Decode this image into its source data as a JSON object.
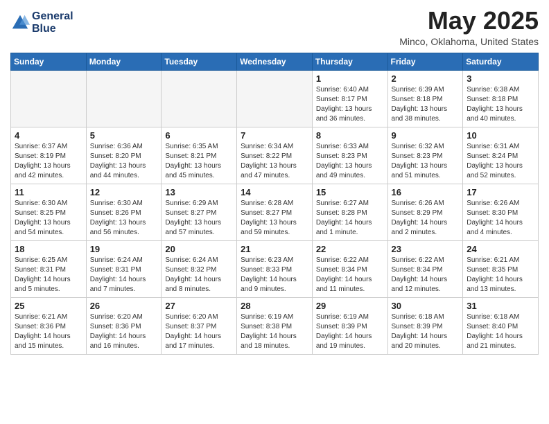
{
  "header": {
    "logo_line1": "General",
    "logo_line2": "Blue",
    "month_title": "May 2025",
    "subtitle": "Minco, Oklahoma, United States"
  },
  "days_of_week": [
    "Sunday",
    "Monday",
    "Tuesday",
    "Wednesday",
    "Thursday",
    "Friday",
    "Saturday"
  ],
  "weeks": [
    [
      {
        "day": "",
        "info": ""
      },
      {
        "day": "",
        "info": ""
      },
      {
        "day": "",
        "info": ""
      },
      {
        "day": "",
        "info": ""
      },
      {
        "day": "1",
        "info": "Sunrise: 6:40 AM\nSunset: 8:17 PM\nDaylight: 13 hours\nand 36 minutes."
      },
      {
        "day": "2",
        "info": "Sunrise: 6:39 AM\nSunset: 8:18 PM\nDaylight: 13 hours\nand 38 minutes."
      },
      {
        "day": "3",
        "info": "Sunrise: 6:38 AM\nSunset: 8:18 PM\nDaylight: 13 hours\nand 40 minutes."
      }
    ],
    [
      {
        "day": "4",
        "info": "Sunrise: 6:37 AM\nSunset: 8:19 PM\nDaylight: 13 hours\nand 42 minutes."
      },
      {
        "day": "5",
        "info": "Sunrise: 6:36 AM\nSunset: 8:20 PM\nDaylight: 13 hours\nand 44 minutes."
      },
      {
        "day": "6",
        "info": "Sunrise: 6:35 AM\nSunset: 8:21 PM\nDaylight: 13 hours\nand 45 minutes."
      },
      {
        "day": "7",
        "info": "Sunrise: 6:34 AM\nSunset: 8:22 PM\nDaylight: 13 hours\nand 47 minutes."
      },
      {
        "day": "8",
        "info": "Sunrise: 6:33 AM\nSunset: 8:23 PM\nDaylight: 13 hours\nand 49 minutes."
      },
      {
        "day": "9",
        "info": "Sunrise: 6:32 AM\nSunset: 8:23 PM\nDaylight: 13 hours\nand 51 minutes."
      },
      {
        "day": "10",
        "info": "Sunrise: 6:31 AM\nSunset: 8:24 PM\nDaylight: 13 hours\nand 52 minutes."
      }
    ],
    [
      {
        "day": "11",
        "info": "Sunrise: 6:30 AM\nSunset: 8:25 PM\nDaylight: 13 hours\nand 54 minutes."
      },
      {
        "day": "12",
        "info": "Sunrise: 6:30 AM\nSunset: 8:26 PM\nDaylight: 13 hours\nand 56 minutes."
      },
      {
        "day": "13",
        "info": "Sunrise: 6:29 AM\nSunset: 8:27 PM\nDaylight: 13 hours\nand 57 minutes."
      },
      {
        "day": "14",
        "info": "Sunrise: 6:28 AM\nSunset: 8:27 PM\nDaylight: 13 hours\nand 59 minutes."
      },
      {
        "day": "15",
        "info": "Sunrise: 6:27 AM\nSunset: 8:28 PM\nDaylight: 14 hours\nand 1 minute."
      },
      {
        "day": "16",
        "info": "Sunrise: 6:26 AM\nSunset: 8:29 PM\nDaylight: 14 hours\nand 2 minutes."
      },
      {
        "day": "17",
        "info": "Sunrise: 6:26 AM\nSunset: 8:30 PM\nDaylight: 14 hours\nand 4 minutes."
      }
    ],
    [
      {
        "day": "18",
        "info": "Sunrise: 6:25 AM\nSunset: 8:31 PM\nDaylight: 14 hours\nand 5 minutes."
      },
      {
        "day": "19",
        "info": "Sunrise: 6:24 AM\nSunset: 8:31 PM\nDaylight: 14 hours\nand 7 minutes."
      },
      {
        "day": "20",
        "info": "Sunrise: 6:24 AM\nSunset: 8:32 PM\nDaylight: 14 hours\nand 8 minutes."
      },
      {
        "day": "21",
        "info": "Sunrise: 6:23 AM\nSunset: 8:33 PM\nDaylight: 14 hours\nand 9 minutes."
      },
      {
        "day": "22",
        "info": "Sunrise: 6:22 AM\nSunset: 8:34 PM\nDaylight: 14 hours\nand 11 minutes."
      },
      {
        "day": "23",
        "info": "Sunrise: 6:22 AM\nSunset: 8:34 PM\nDaylight: 14 hours\nand 12 minutes."
      },
      {
        "day": "24",
        "info": "Sunrise: 6:21 AM\nSunset: 8:35 PM\nDaylight: 14 hours\nand 13 minutes."
      }
    ],
    [
      {
        "day": "25",
        "info": "Sunrise: 6:21 AM\nSunset: 8:36 PM\nDaylight: 14 hours\nand 15 minutes."
      },
      {
        "day": "26",
        "info": "Sunrise: 6:20 AM\nSunset: 8:36 PM\nDaylight: 14 hours\nand 16 minutes."
      },
      {
        "day": "27",
        "info": "Sunrise: 6:20 AM\nSunset: 8:37 PM\nDaylight: 14 hours\nand 17 minutes."
      },
      {
        "day": "28",
        "info": "Sunrise: 6:19 AM\nSunset: 8:38 PM\nDaylight: 14 hours\nand 18 minutes."
      },
      {
        "day": "29",
        "info": "Sunrise: 6:19 AM\nSunset: 8:39 PM\nDaylight: 14 hours\nand 19 minutes."
      },
      {
        "day": "30",
        "info": "Sunrise: 6:18 AM\nSunset: 8:39 PM\nDaylight: 14 hours\nand 20 minutes."
      },
      {
        "day": "31",
        "info": "Sunrise: 6:18 AM\nSunset: 8:40 PM\nDaylight: 14 hours\nand 21 minutes."
      }
    ]
  ]
}
